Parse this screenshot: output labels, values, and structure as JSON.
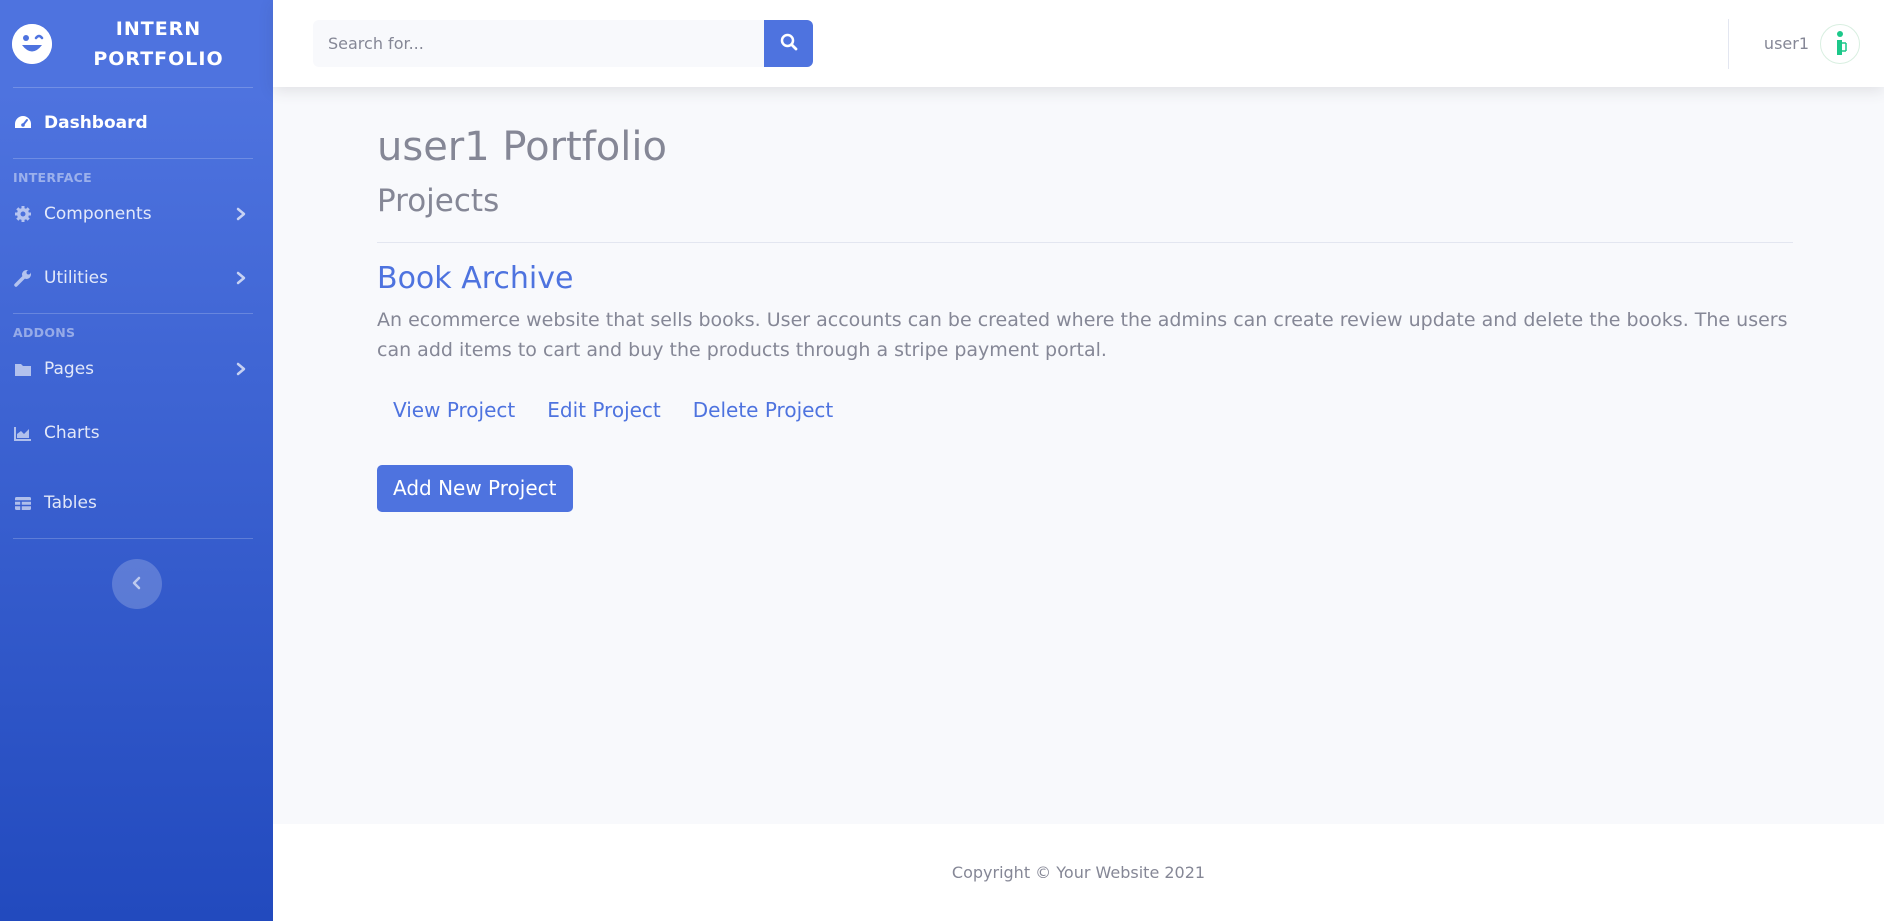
{
  "brand": {
    "line1": "INTERN",
    "line2": "PORTFOLIO",
    "icon": "laugh-wink-icon"
  },
  "sidebar": {
    "dashboard": "Dashboard",
    "heading_interface": "INTERFACE",
    "components": "Components",
    "utilities": "Utilities",
    "heading_addons": "ADDONS",
    "pages": "Pages",
    "charts": "Charts",
    "tables": "Tables"
  },
  "search": {
    "placeholder": "Search for..."
  },
  "user": {
    "name": "user1"
  },
  "main": {
    "title": "user1 Portfolio",
    "section": "Projects",
    "project": {
      "title": "Book Archive",
      "description": "An ecommerce website that sells books. User accounts can be created where the admins can create review update and delete the books. The users can add items to cart and buy the products through a stripe payment portal.",
      "view": "View Project",
      "edit": "Edit Project",
      "delete": "Delete Project"
    },
    "add_button": "Add New Project"
  },
  "footer": {
    "copyright": "Copyright © Your Website 2021"
  },
  "colors": {
    "primary": "#4e73df",
    "gray": "#858796",
    "bg": "#f8f9fc",
    "avatar_accent": "#1cc88a"
  }
}
